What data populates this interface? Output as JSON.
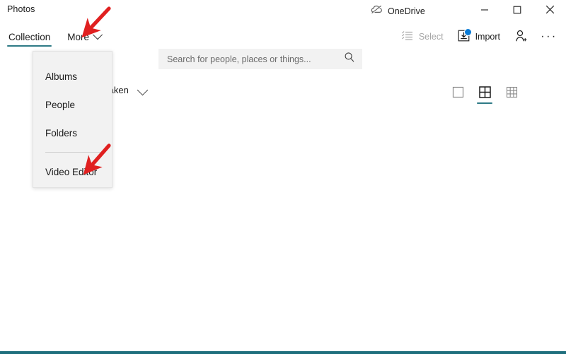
{
  "window": {
    "app_title": "Photos",
    "onedrive": {
      "label": "OneDrive",
      "icon": "onedrive-cloud-disabled-icon"
    },
    "controls": {
      "minimize": "minimize-icon",
      "maximize": "maximize-icon",
      "close": "close-icon"
    }
  },
  "commandbar": {
    "tabs": [
      {
        "label": "Collection",
        "selected": true,
        "has_chevron": false
      },
      {
        "label": "More",
        "selected": false,
        "has_chevron": true
      }
    ],
    "search": {
      "placeholder": "Search for people, places or things...",
      "value": "",
      "icon": "search-icon"
    },
    "actions": [
      {
        "label": "Select",
        "icon": "select-list-icon",
        "disabled": true,
        "badge": false
      },
      {
        "label": "Import",
        "icon": "import-tray-icon",
        "disabled": false,
        "badge": true
      },
      {
        "label": "",
        "icon": "add-person-icon",
        "disabled": false,
        "badge": false
      },
      {
        "label": "···",
        "icon": "more-ellipsis-icon",
        "disabled": false,
        "badge": false
      }
    ]
  },
  "sortbar": {
    "label": "taken",
    "chevron_icon": "chevron-down-icon",
    "view_sizes": [
      {
        "name": "large",
        "icon": "view-large-icon",
        "selected": false
      },
      {
        "name": "medium",
        "icon": "view-medium-grid-icon",
        "selected": true
      },
      {
        "name": "small",
        "icon": "view-small-grid-icon",
        "selected": false
      }
    ]
  },
  "more_menu": {
    "items": [
      {
        "label": "Albums"
      },
      {
        "label": "People"
      },
      {
        "label": "Folders"
      }
    ],
    "divider": true,
    "footer_items": [
      {
        "label": "Video Editor"
      }
    ]
  },
  "annotations": {
    "arrow_color": "#e02020",
    "arrows": [
      {
        "name": "arrow-to-more-tab",
        "target": "More"
      },
      {
        "name": "arrow-to-video-editor",
        "target": "Video Editor"
      }
    ]
  },
  "theme": {
    "accent": "#2e7a86",
    "badge": "#0a7bd6",
    "flyout_bg": "#f2f2f2",
    "search_bg": "#f2f2f2",
    "disabled_text": "#a6a6a6"
  }
}
